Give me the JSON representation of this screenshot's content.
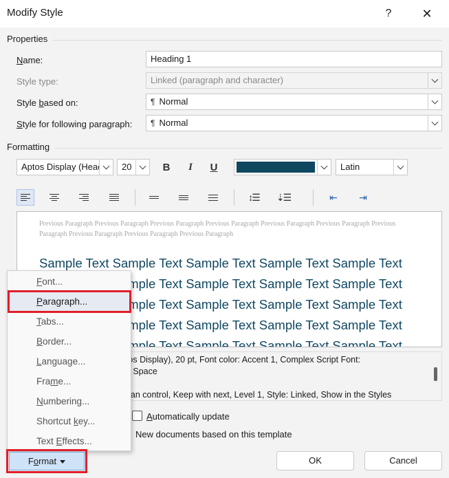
{
  "window": {
    "title": "Modify Style",
    "help_glyph": "?",
    "close_glyph": "✕"
  },
  "properties": {
    "group_label": "Properties",
    "name_label": "Name:",
    "name_value": "Heading 1",
    "style_type_label": "Style type:",
    "style_type_value": "Linked (paragraph and character)",
    "based_on_label": "Style based on:",
    "based_on_value": "Normal",
    "following_label": "Style for following paragraph:",
    "following_value": "Normal"
  },
  "formatting": {
    "group_label": "Formatting",
    "font_value": "Aptos Display (Head",
    "size_value": "20",
    "bold_glyph": "B",
    "italic_glyph": "I",
    "underline_glyph": "U",
    "font_color": "#0f4761",
    "script_value": "Latin"
  },
  "preview": {
    "previous_paragraph": "Previous Paragraph Previous Paragraph Previous Paragraph Previous Paragraph Previous Paragraph Previous Paragraph Previous Paragraph Previous Paragraph Previous Paragraph Previous Paragraph",
    "sample_lines": [
      "Sample Text Sample Text Sample Text Sample Text Sample Text",
      "Sample Text Sample Text Sample Text Sample Text Sample Text",
      "Sample Text Sample Text Sample Text Sample Text Sample Text",
      "Sample Text Sample Text Sample Text Sample Text Sample Text",
      "Sample Text Sample Text Sample Text Sample Text Sample Text"
    ],
    "sample_color": "#0f4761"
  },
  "description": {
    "lines": [
      "ptos Display), 20 pt, Font color: Accent 1, Complex Script Font:",
      "pt, Space",
      "phan control, Keep with next, Level 1, Style: Linked, Show in the Styles"
    ]
  },
  "options": {
    "auto_update_label": "Automatically update",
    "new_docs_label": "New documents based on this template"
  },
  "menu": {
    "items": [
      {
        "label": "Font...",
        "accel": "F"
      },
      {
        "label": "Paragraph...",
        "accel": "P"
      },
      {
        "label": "Tabs...",
        "accel": "T"
      },
      {
        "label": "Border...",
        "accel": "B"
      },
      {
        "label": "Language...",
        "accel": "L"
      },
      {
        "label": "Frame...",
        "accel": "M"
      },
      {
        "label": "Numbering...",
        "accel": "N"
      },
      {
        "label": "Shortcut key...",
        "accel": "K"
      },
      {
        "label": "Text Effects...",
        "accel": "E"
      }
    ],
    "highlight_color": "#e01e2a"
  },
  "buttons": {
    "format_label": "Format",
    "ok_label": "OK",
    "cancel_label": "Cancel"
  }
}
